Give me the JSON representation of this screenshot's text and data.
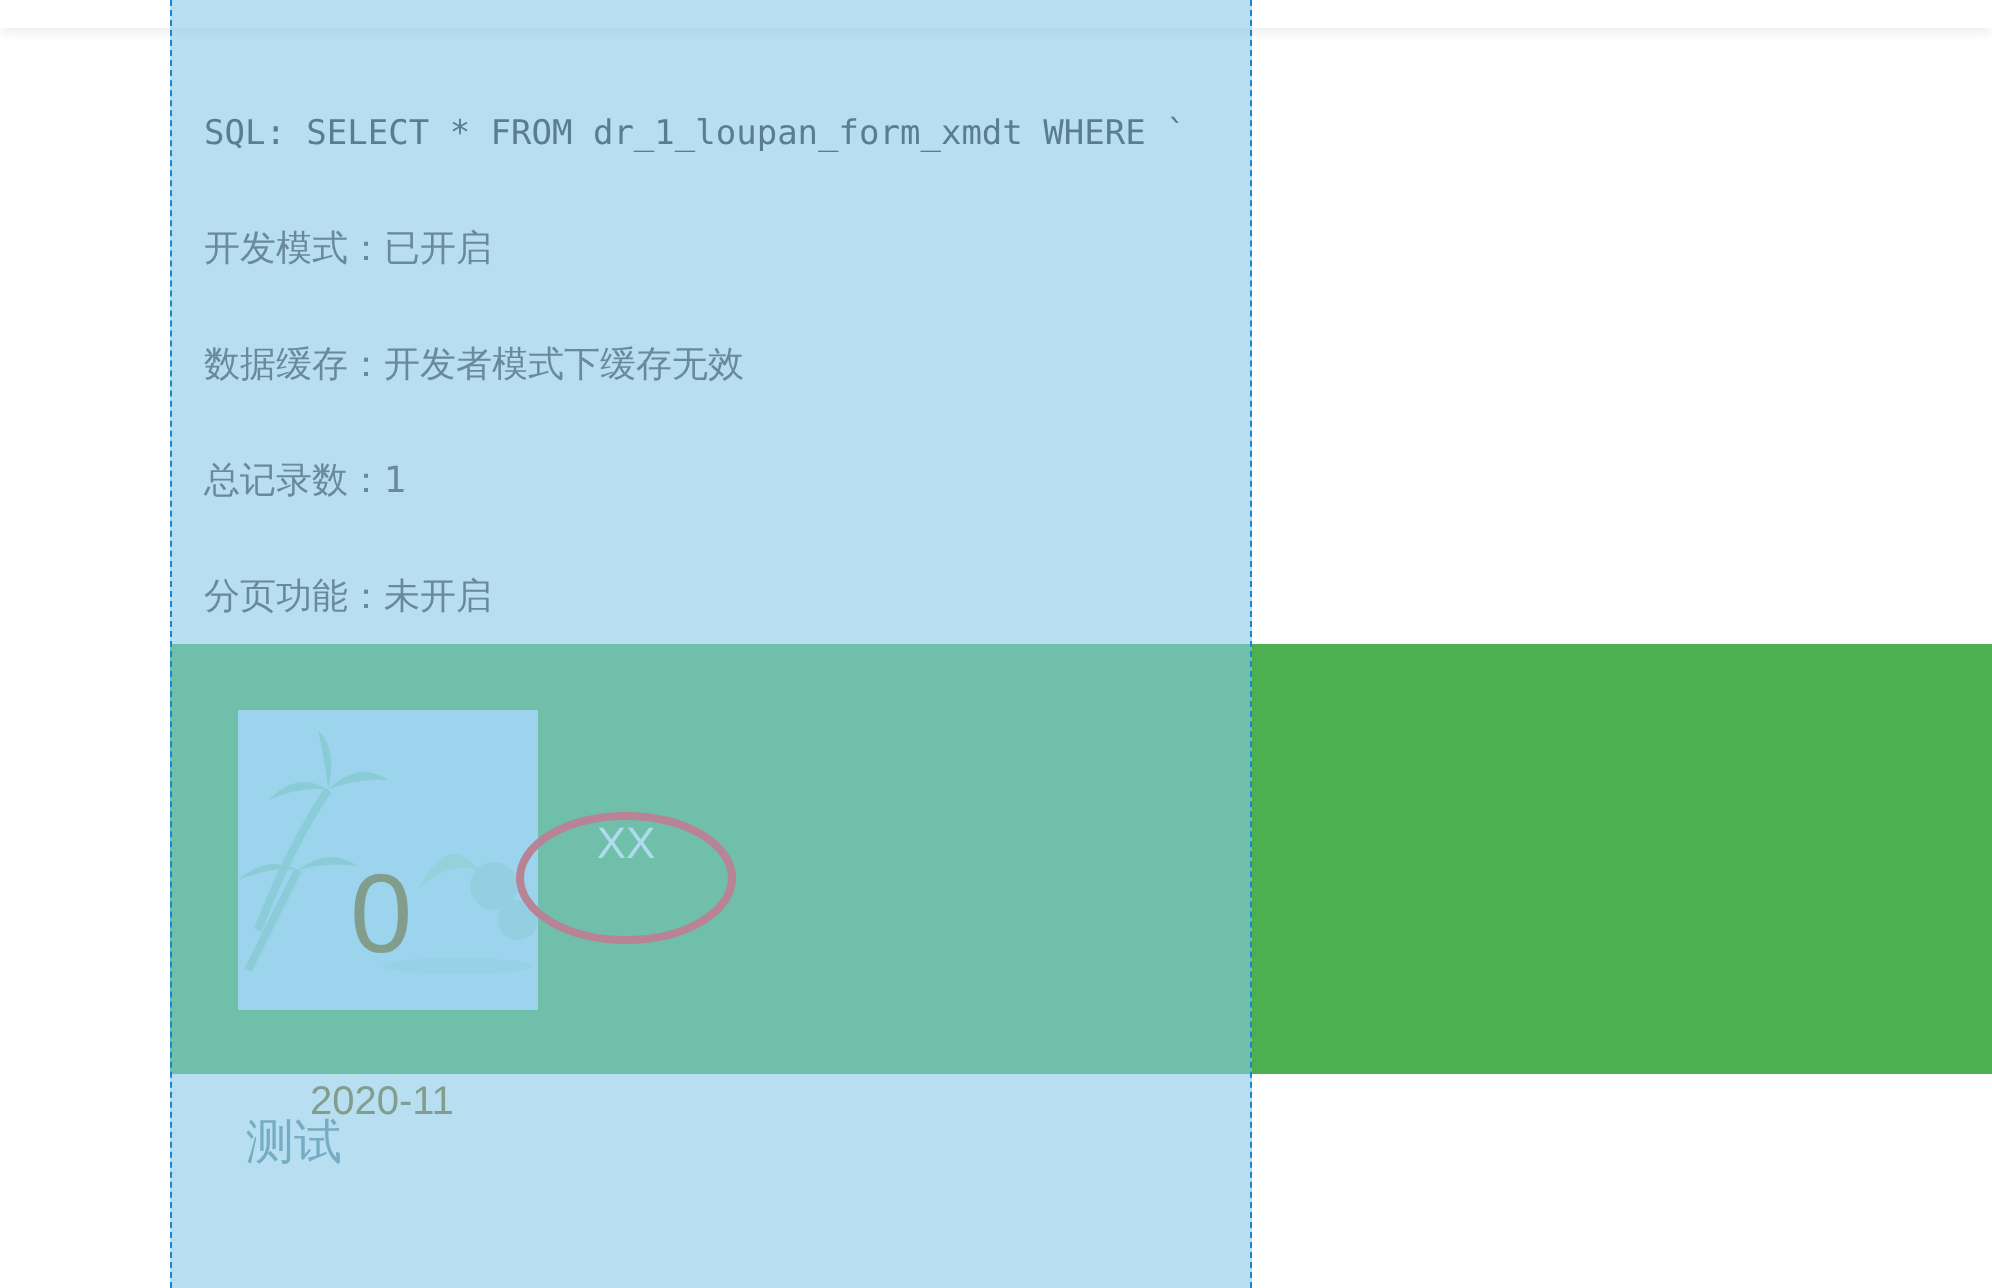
{
  "debug_panel": {
    "lines": [
      {
        "kind": "code",
        "text": "SQL: SELECT * FROM dr_1_loupan_form_xmdt WHERE `"
      },
      {
        "kind": "text",
        "text": "开发模式：已开启"
      },
      {
        "kind": "text",
        "text": "数据缓存：开发者模式下缓存无效"
      },
      {
        "kind": "text",
        "text": "总记录数：1"
      },
      {
        "kind": "text",
        "text": "分页功能：未开启"
      }
    ]
  },
  "banner": {
    "card": {
      "image_number": "0",
      "date": "2020-11",
      "title": "测试"
    },
    "label": "XX"
  }
}
